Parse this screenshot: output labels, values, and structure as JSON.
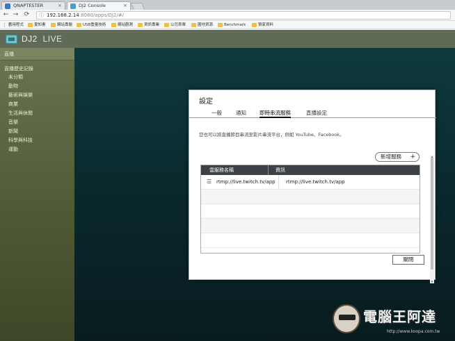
{
  "browser": {
    "tabs": [
      {
        "title": "QNAPTESTER",
        "active": false,
        "favicon_color": "#3b78c2"
      },
      {
        "title": "DJ2 Console",
        "active": true,
        "favicon_color": "#4a9fc4"
      }
    ],
    "url_host": "192.168.2.14",
    "url_path": ":8080/apps/DJ2/#/",
    "bookmarks": [
      "應用程式",
      "夏知書",
      "網站專題",
      "USB重量技術",
      "網站觀測",
      "資訊專業",
      "公司表單",
      "園地資源",
      "Benchmark",
      "贊家資料"
    ]
  },
  "app": {
    "title": "DJ2",
    "title_suffix": "LIVE"
  },
  "sidebar": {
    "live": "直播",
    "history_group": "直播歷史記錄",
    "items": [
      "未分類",
      "動物",
      "藝術與娛樂",
      "商業",
      "生活與休閒",
      "音樂",
      "新聞",
      "科學與科技",
      "運動"
    ]
  },
  "dialog": {
    "title": "設定",
    "tabs": [
      "一般",
      "通知",
      "即時串流服務",
      "直播設定"
    ],
    "active_tab": 2,
    "description": "您也可以將直播節目串流至影片串流平台，例如 YouTube、Facebook。",
    "add_button": "新增服務",
    "table": {
      "headers": [
        "雲服務名稱",
        "資訊"
      ],
      "rows": [
        [
          "rtmp://live.twitch.tv/app",
          "rtmp://live.twitch.tv/app"
        ]
      ]
    },
    "close_button": "關閉"
  },
  "watermark": {
    "text": "電腦王阿達",
    "url": "http://www.koopa.com.tw"
  }
}
